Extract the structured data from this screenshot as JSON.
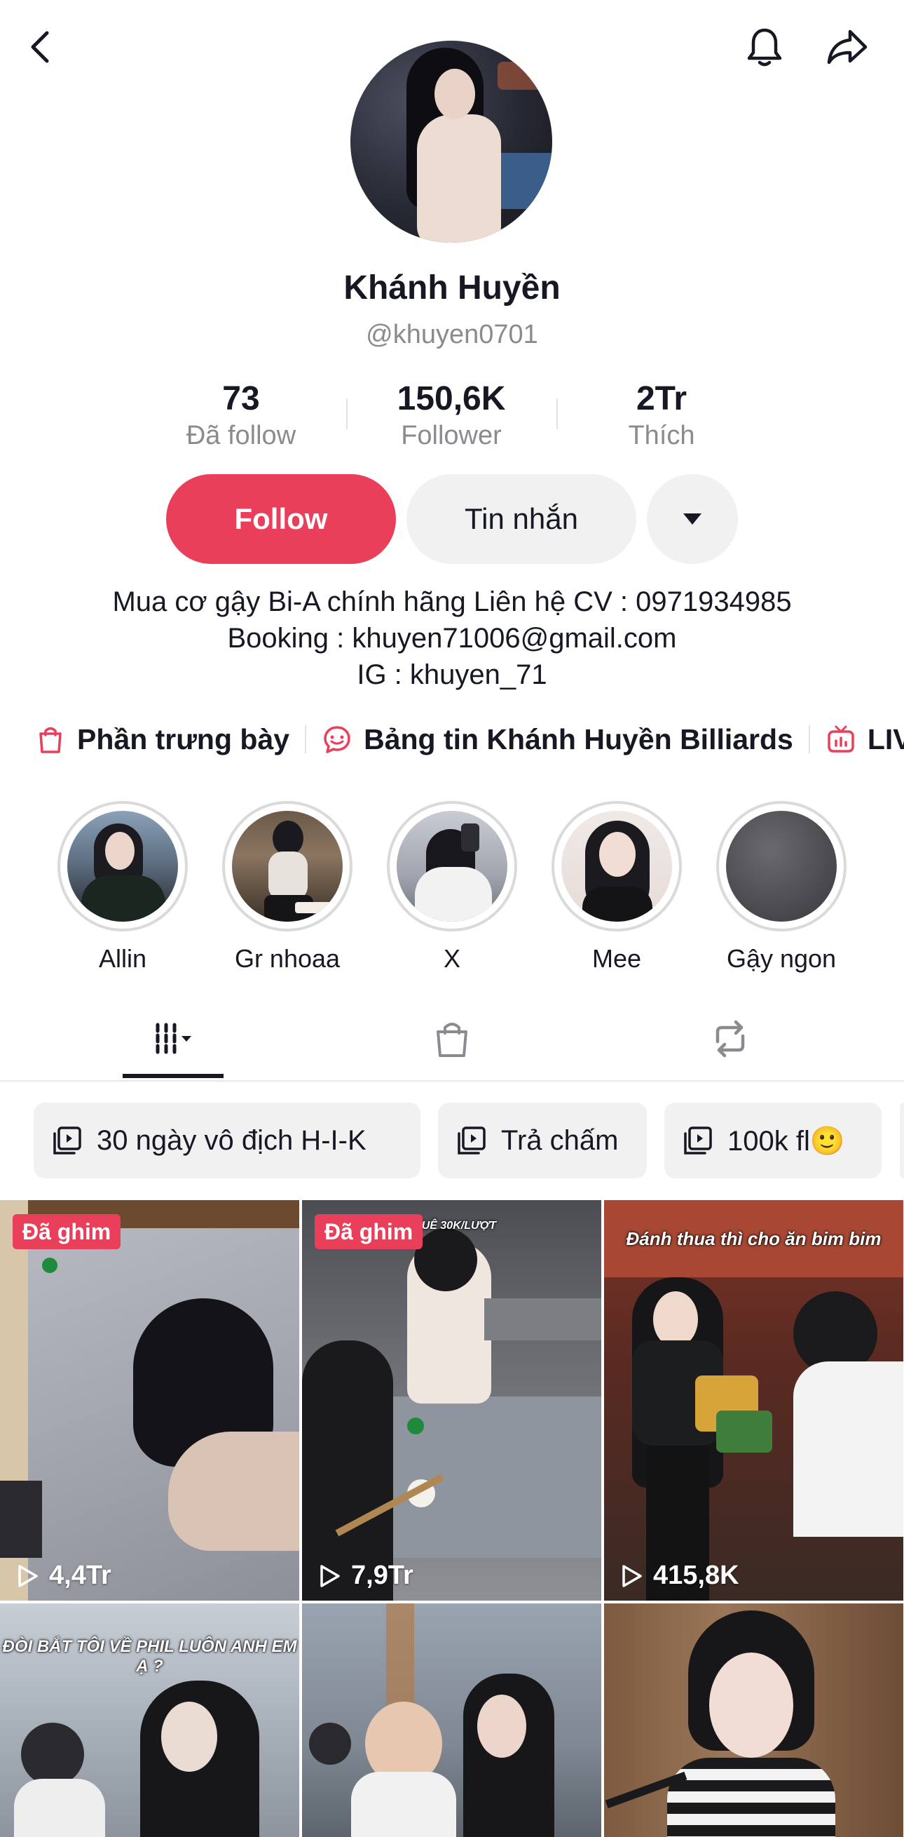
{
  "topbar": {
    "back_icon": "chevron-left-icon",
    "bell_icon": "bell-icon",
    "share_icon": "share-arrow-icon"
  },
  "profile": {
    "name": "Khánh Huyền",
    "handle": "@khuyen0701"
  },
  "stats": [
    {
      "value": "73",
      "label": "Đã follow"
    },
    {
      "value": "150,6K",
      "label": "Follower"
    },
    {
      "value": "2Tr",
      "label": "Thích"
    }
  ],
  "actions": {
    "follow_label": "Follow",
    "message_label": "Tin nhắn",
    "more_icon": "caret-down-icon",
    "follow_color": "#ea3f5a"
  },
  "bio": {
    "line1": "Mua cơ gậy Bi-A chính hãng Liên hệ CV : 0971934985",
    "line2": "Booking : khuyen71006@gmail.com",
    "line3": "IG : khuyen_71"
  },
  "links": [
    {
      "icon": "shopping-bag-icon",
      "label": "Phần trưng bày"
    },
    {
      "icon": "chat-bubble-icon",
      "label": "Bảng tin Khánh Huyền Billiards"
    },
    {
      "icon": "live-tv-icon",
      "label": "LIV"
    }
  ],
  "highlights": [
    {
      "label": "Allin"
    },
    {
      "label": "Gr nhoaa"
    },
    {
      "label": "X"
    },
    {
      "label": "Mee"
    },
    {
      "label": "Gậy ngon"
    }
  ],
  "tabs": [
    {
      "icon": "video-grid-icon",
      "active": true
    },
    {
      "icon": "shopping-bag-icon",
      "active": false
    },
    {
      "icon": "repost-icon",
      "active": false
    }
  ],
  "playlists": [
    {
      "label": "30 ngày vô địch H-I-K"
    },
    {
      "label": "Trả chấm"
    },
    {
      "label": "100k fl🙂"
    }
  ],
  "videos": [
    {
      "pinned": "Đã ghim",
      "views": "4,4Tr",
      "caption": ""
    },
    {
      "pinned": "Đã ghim",
      "views": "7,9Tr",
      "caption": "CƠ THUÊ 30K/LƯỢT"
    },
    {
      "pinned": "",
      "views": "415,8K",
      "caption": "Đánh thua thì cho ăn bim bim"
    },
    {
      "pinned": "",
      "views": "",
      "caption": "ĐÒI BẮT TÔI VỀ PHIL LUÔN ANH EM Ạ ?"
    },
    {
      "pinned": "",
      "views": "",
      "caption": ""
    },
    {
      "pinned": "",
      "views": "",
      "caption": ""
    }
  ]
}
